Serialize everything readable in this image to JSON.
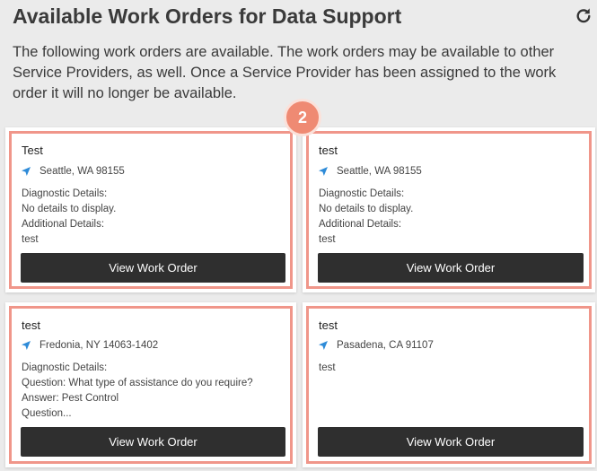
{
  "header": {
    "title": "Available Work Orders for Data Support",
    "refresh_icon": "refresh-icon"
  },
  "intro": "The following work orders are available. The work orders may be available to other Service Providers, as well. Once a Service Provider has been assigned to the work order it will no longer be available.",
  "step_badge": "2",
  "colors": {
    "highlight": "#f0968a",
    "badge": "#ef8a73",
    "button": "#2f2f2f",
    "location_icon": "#2e8bd8"
  },
  "cards": [
    {
      "title": "Test",
      "location": "Seattle, WA 98155",
      "details": [
        "Diagnostic Details:",
        "No details to display.",
        "Additional Details:",
        "test"
      ],
      "button": "View Work Order"
    },
    {
      "title": "test",
      "location": "Seattle, WA 98155",
      "details": [
        "Diagnostic Details:",
        "No details to display.",
        "Additional Details:",
        "test"
      ],
      "button": "View Work Order"
    },
    {
      "title": "test",
      "location": "Fredonia, NY 14063-1402",
      "details": [
        "Diagnostic Details:",
        "Question: What type of assistance do you require?",
        "Answer: Pest Control",
        "Question..."
      ],
      "button": "View Work Order"
    },
    {
      "title": "test",
      "location": "Pasadena, CA 91107",
      "details": [
        "test"
      ],
      "button": "View Work Order"
    }
  ]
}
